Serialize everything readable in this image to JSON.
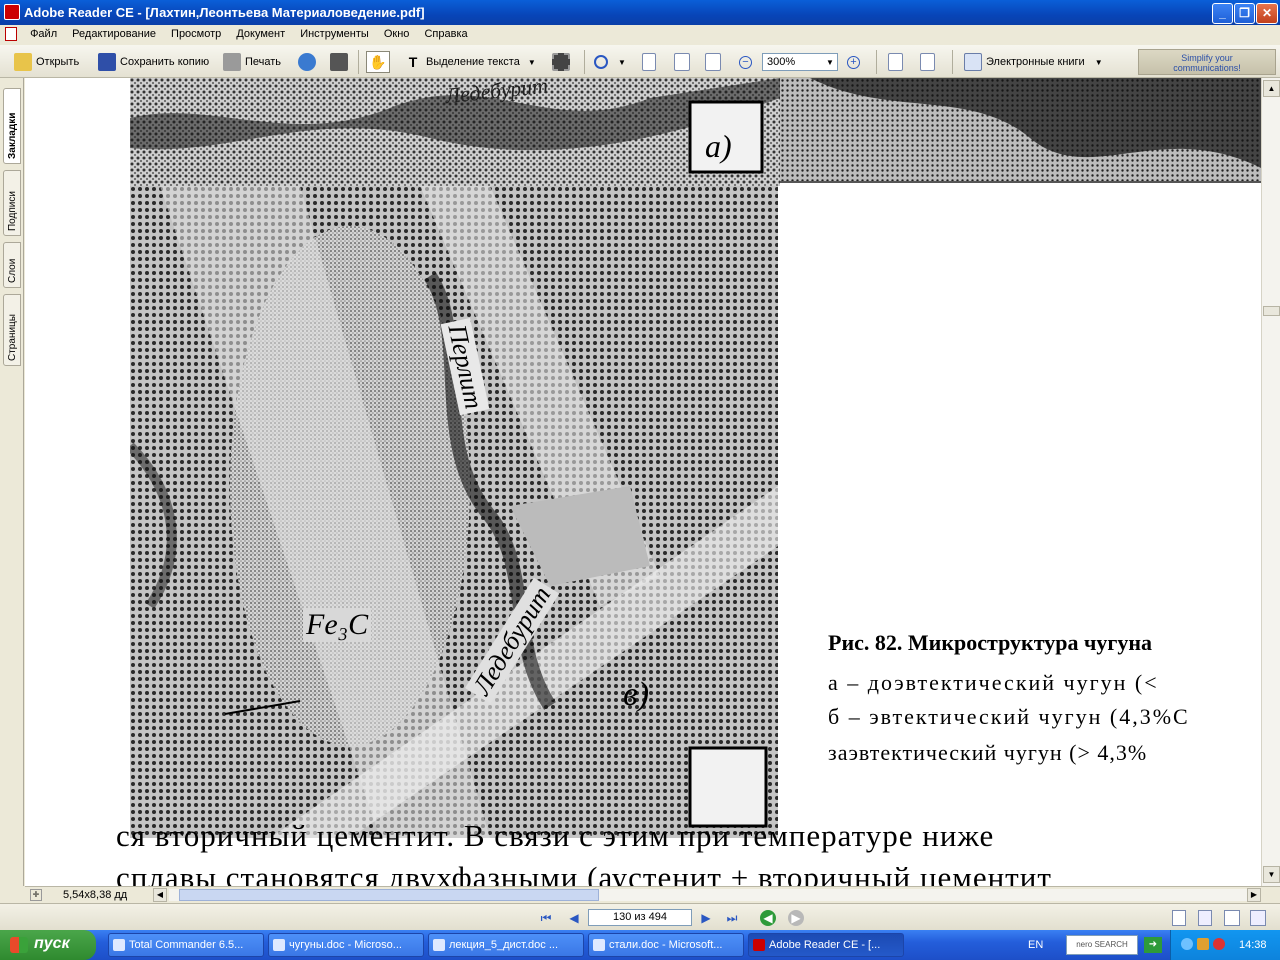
{
  "window": {
    "title": "Adobe Reader CE - [Лахтин,Леонтьева Материаловедение.pdf]",
    "minimize": "_",
    "restore": "❐",
    "close": "✕"
  },
  "menu": [
    "Файл",
    "Редактирование",
    "Просмотр",
    "Документ",
    "Инструменты",
    "Окно",
    "Справка"
  ],
  "toolbar": {
    "open_label": "Открыть",
    "save_copy_label": "Сохранить копию",
    "print_label": "Печать",
    "select_text_label": "Выделение текста",
    "zoom_value": "300%",
    "ebooks_label": "Электронные книги",
    "promo_line1": "Simplify your",
    "promo_line2": "communications!"
  },
  "nav_tabs": [
    "Закладки",
    "Подписи",
    "Слои",
    "Страницы"
  ],
  "document": {
    "fig_label_a": "a)",
    "fig_label_v": "в)",
    "fig_text_ledeburit_top": "Ледебурит",
    "fig_text_perlit": "Перлит",
    "fig_text_ledeburit": "Ледебурит",
    "fig_text_fe3c": "Fe₃C",
    "caption_title": "Рис. 82. Микроструктура чугуна",
    "caption_a": "а – доэвтектический чугун (<",
    "caption_b": "б – эвтектический чугун (4,3%С",
    "caption_c": "заэвтектический чугун (> 4,3%",
    "body_line1": "ся вторичный цементит. В связи с этим при температуре ниже",
    "body_line2": "сплавы становятся двухфазными (аустенит + вторичный цементит"
  },
  "status": {
    "page_size": "5,54x8,38 дд",
    "page_indicator": "130 из 494"
  },
  "taskbar": {
    "start_label": "пуск",
    "tasks": [
      "Total Commander 6.5...",
      "чугуны.doc - Microso...",
      "лекция_5_дист.doc ...",
      "стали.doc - Microsoft...",
      "Adobe Reader CE - [..."
    ],
    "lang": "EN",
    "search_label": "nero SEARCH",
    "clock": "14:38"
  },
  "colors": {
    "titlebar": "#0845b8",
    "taskbar": "#245edb",
    "start": "#2f8a2f"
  }
}
